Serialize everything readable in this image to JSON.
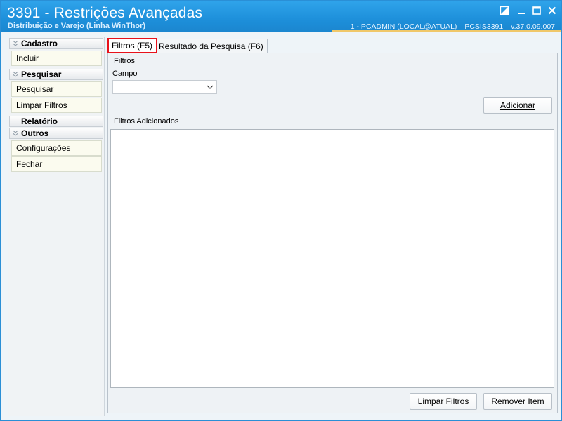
{
  "window": {
    "title": "3391 - Restrições Avançadas",
    "subtitle": "Distribuição e Varejo (Linha WinThor)",
    "user_info": "1 - PCADMIN (LOCAL@ATUAL)",
    "routine": "PCSIS3391",
    "version": "v.37.0.09.007"
  },
  "sidebar": {
    "groups": [
      {
        "label": "Cadastro",
        "items": [
          {
            "label": "Incluir"
          }
        ]
      },
      {
        "label": "Pesquisar",
        "items": [
          {
            "label": "Pesquisar"
          },
          {
            "label": "Limpar Filtros"
          }
        ]
      },
      {
        "label": "Relatório",
        "items": []
      },
      {
        "label": "Outros",
        "items": [
          {
            "label": "Configurações"
          },
          {
            "label": "Fechar"
          }
        ]
      }
    ]
  },
  "tabs": [
    {
      "label": "Filtros (F5)",
      "active": true
    },
    {
      "label": "Resultado da Pesquisa (F6)",
      "active": false
    }
  ],
  "filtros": {
    "group_title": "Filtros",
    "campo_label": "Campo",
    "campo_value": "",
    "add_button": "Adicionar"
  },
  "added": {
    "group_title": "Filtros Adicionados",
    "clear_button": "Limpar Filtros",
    "remove_button": "Remover Item"
  },
  "colors": {
    "titlebar": "#1d8fda",
    "tab_highlight": "#e8121b",
    "accent_line": "#f0c86a"
  }
}
